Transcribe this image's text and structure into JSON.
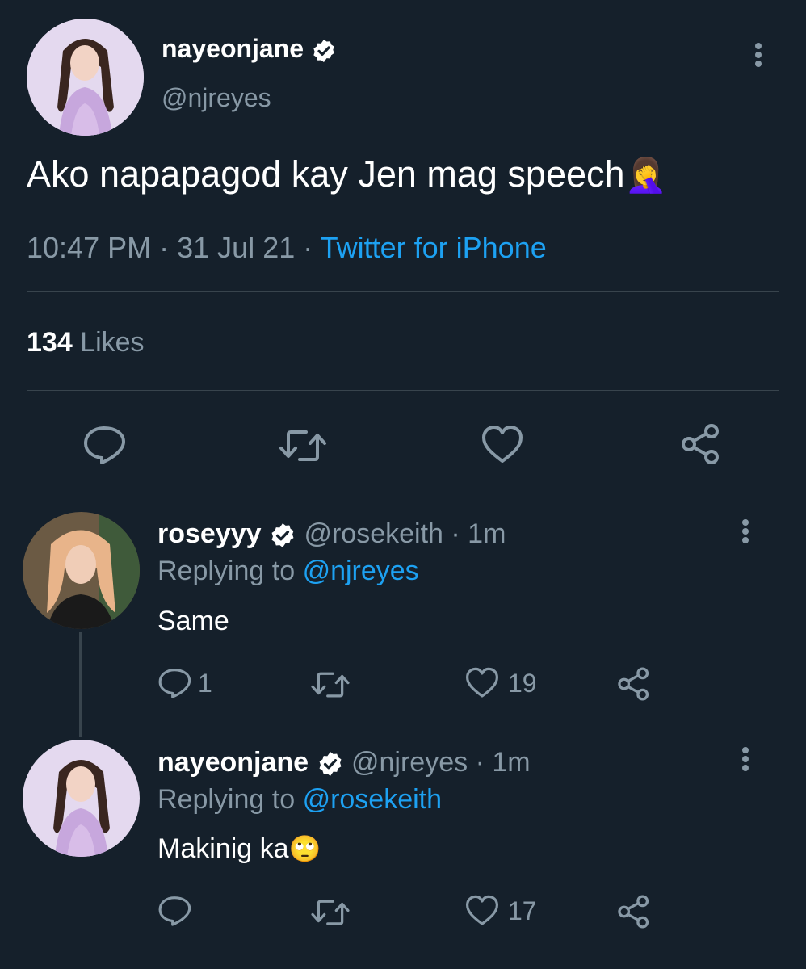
{
  "main_tweet": {
    "display_name": "nayeonjane",
    "handle": "@njreyes",
    "text": "Ako napapagod kay Jen mag speech",
    "emoji": "🤦‍♀️",
    "time": "10:47 PM",
    "sep1": "·",
    "date": "31 Jul 21",
    "sep2": "·",
    "source": "Twitter for iPhone",
    "likes_count": "134",
    "likes_label": "Likes"
  },
  "replies": [
    {
      "display_name": "roseyyy",
      "handle": "@rosekeith",
      "time": "· 1m",
      "replying_prefix": "Replying to",
      "replying_to": "@njreyes",
      "text": "Same",
      "emoji": "",
      "reply_count": "1",
      "like_count": "19"
    },
    {
      "display_name": "nayeonjane",
      "handle": "@njreyes",
      "time": "· 1m",
      "replying_prefix": "Replying to",
      "replying_to": "@rosekeith",
      "text": "Makinig ka",
      "emoji": "🙄",
      "reply_count": "",
      "like_count": "17"
    }
  ],
  "icons": {
    "reply": "comment-icon",
    "retweet": "retweet-icon",
    "like": "heart-icon",
    "share": "share-icon",
    "more": "kebab-menu-icon",
    "verified": "verified-badge-icon"
  },
  "colors": {
    "background": "#15202b",
    "muted": "#8899a6",
    "link": "#1da1f2",
    "divider": "#38444d"
  }
}
